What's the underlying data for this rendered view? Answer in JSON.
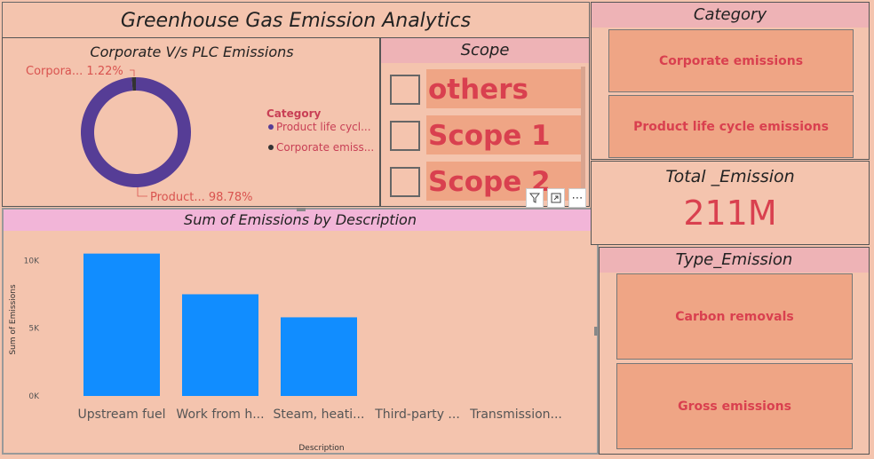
{
  "header": {
    "title": "Greenhouse Gas Emission Analytics"
  },
  "donut": {
    "title": "Corporate V/s PLC Emissions",
    "slices": [
      {
        "name": "Product life cycle emissions",
        "percent": 98.78,
        "label": "Product... 98.78%",
        "color": "#563d96"
      },
      {
        "name": "Corporate emissions",
        "percent": 1.22,
        "label": "Corpora... 1.22%",
        "color": "#333333"
      }
    ],
    "legend": {
      "title": "Category",
      "items": [
        {
          "label": "Product life cycl...",
          "color": "#563d96"
        },
        {
          "label": "Corporate emiss...",
          "color": "#333333"
        }
      ]
    }
  },
  "scope": {
    "title": "Scope",
    "items": [
      {
        "label": "others"
      },
      {
        "label": "Scope 1"
      },
      {
        "label": "Scope 2"
      }
    ]
  },
  "toolbar": {
    "filter_icon": "filter-icon",
    "focus_icon": "focus-mode-icon",
    "more_icon": "more-options-icon"
  },
  "bar_chart": {
    "title": "Sum of Emissions by Description"
  },
  "chart_data": {
    "type": "bar",
    "title": "Sum of Emissions by Description",
    "xlabel": "Description",
    "ylabel": "Sum of Emissions",
    "categories": [
      "Upstream fuel",
      "Work from h...",
      "Steam, heati...",
      "Third-party ...",
      "Transmission..."
    ],
    "values": [
      10500,
      7500,
      5800,
      0,
      0
    ],
    "yticks": [
      {
        "value": 0,
        "label": "0K"
      },
      {
        "value": 5000,
        "label": "5K"
      },
      {
        "value": 10000,
        "label": "10K"
      }
    ],
    "ylim": [
      0,
      11000
    ],
    "color": "#118dff",
    "grid": false
  },
  "category": {
    "title": "Category",
    "items": [
      {
        "label": "Corporate emissions"
      },
      {
        "label": "Product life cycle emissions"
      }
    ]
  },
  "total": {
    "title": "Total _Emission",
    "value": "211M"
  },
  "type_emission": {
    "title": "Type_Emission",
    "items": [
      {
        "label": "Carbon removals"
      },
      {
        "label": "Gross emissions"
      }
    ]
  }
}
